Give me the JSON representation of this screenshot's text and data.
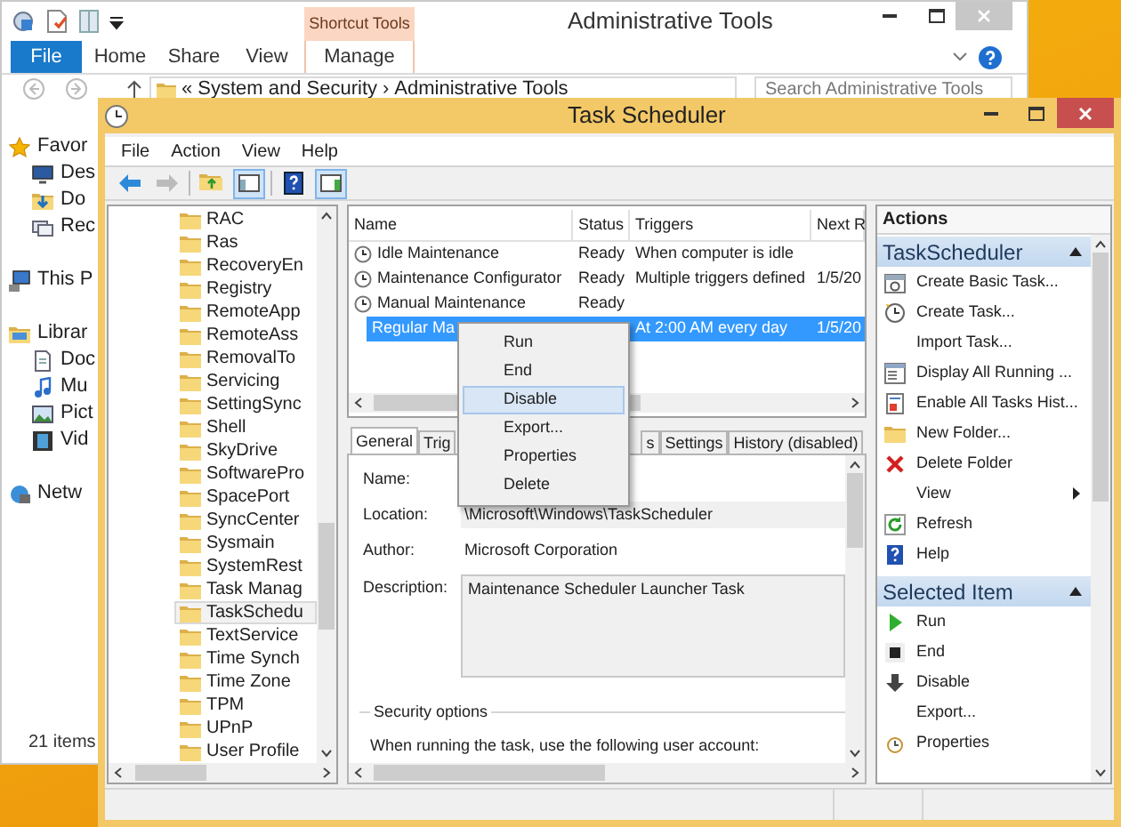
{
  "explorer": {
    "title": "Administrative Tools",
    "context_tab": "Shortcut Tools",
    "ribbon_tabs": [
      {
        "label": "File",
        "kind": "file"
      },
      {
        "label": "Home",
        "kind": "tab"
      },
      {
        "label": "Share",
        "kind": "tab"
      },
      {
        "label": "View",
        "kind": "tab"
      },
      {
        "label": "Manage",
        "kind": "contextual"
      }
    ],
    "address": {
      "overflow": "«",
      "parts": [
        "System and Security",
        "Administrative Tools"
      ],
      "separator": "›"
    },
    "search": {
      "placeholder": "Search Administrative Tools"
    },
    "nav": [
      {
        "label": "Favor",
        "kind": "favorites",
        "children": [
          {
            "label": "Des",
            "kind": "desktop"
          },
          {
            "label": "Do",
            "kind": "downloads"
          },
          {
            "label": "Rec",
            "kind": "recent"
          }
        ]
      },
      {
        "label": "This P",
        "kind": "pc"
      },
      {
        "label": "Librar",
        "kind": "libraries",
        "children": [
          {
            "label": "Doc",
            "kind": "documents"
          },
          {
            "label": "Mu",
            "kind": "music"
          },
          {
            "label": "Pict",
            "kind": "pictures"
          },
          {
            "label": "Vid",
            "kind": "videos"
          }
        ]
      },
      {
        "label": "Netw",
        "kind": "network"
      }
    ],
    "status": "21 items"
  },
  "task_scheduler": {
    "title": "Task Scheduler",
    "menu": [
      "File",
      "Action",
      "View",
      "Help"
    ],
    "toolbar": [
      {
        "kind": "back",
        "pressed": false,
        "disabled": false
      },
      {
        "kind": "forward",
        "pressed": false,
        "disabled": true
      },
      {
        "kind": "up",
        "pressed": false,
        "disabled": false
      },
      {
        "kind": "tree",
        "pressed": true,
        "disabled": false
      },
      {
        "kind": "help",
        "pressed": false,
        "disabled": false
      },
      {
        "kind": "actions",
        "pressed": true,
        "disabled": false
      }
    ],
    "tree": [
      {
        "label": "RAC",
        "selected": false
      },
      {
        "label": "Ras",
        "selected": false
      },
      {
        "label": "RecoveryEn",
        "selected": false
      },
      {
        "label": "Registry",
        "selected": false
      },
      {
        "label": "RemoteApp",
        "selected": false
      },
      {
        "label": "RemoteAss",
        "selected": false
      },
      {
        "label": "RemovalTo",
        "selected": false
      },
      {
        "label": "Servicing",
        "selected": false
      },
      {
        "label": "SettingSync",
        "selected": false
      },
      {
        "label": "Shell",
        "selected": false
      },
      {
        "label": "SkyDrive",
        "selected": false
      },
      {
        "label": "SoftwarePro",
        "selected": false
      },
      {
        "label": "SpacePort",
        "selected": false
      },
      {
        "label": "SyncCenter",
        "selected": false
      },
      {
        "label": "Sysmain",
        "selected": false
      },
      {
        "label": "SystemRest",
        "selected": false
      },
      {
        "label": "Task Manag",
        "selected": false
      },
      {
        "label": "TaskSchedu",
        "selected": true
      },
      {
        "label": "TextService",
        "selected": false
      },
      {
        "label": "Time Synch",
        "selected": false
      },
      {
        "label": "Time Zone",
        "selected": false
      },
      {
        "label": "TPM",
        "selected": false
      },
      {
        "label": "UPnP",
        "selected": false
      },
      {
        "label": "User Profile",
        "selected": false
      }
    ],
    "tasks": {
      "columns": [
        "Name",
        "Status",
        "Triggers",
        "Next R"
      ],
      "rows": [
        {
          "name": "Idle Maintenance",
          "status": "Ready",
          "triggers": "When computer is idle",
          "selected": false
        },
        {
          "name": "Maintenance Configurator",
          "status": "Ready",
          "triggers": "Multiple triggers defined",
          "next_run": "1/5/20",
          "selected": false
        },
        {
          "name": "Manual Maintenance",
          "status": "Ready",
          "selected": false
        },
        {
          "name": "Regular Ma",
          "triggers": "At 2:00 AM every day",
          "next_run": "1/5/20",
          "selected": true
        }
      ]
    },
    "context_menu": [
      {
        "label": "Run",
        "selected": false
      },
      {
        "label": "End",
        "selected": false
      },
      {
        "label": "Disable",
        "selected": true
      },
      {
        "label": "Export...",
        "selected": false
      },
      {
        "label": "Properties",
        "selected": false
      },
      {
        "label": "Delete",
        "selected": false
      }
    ],
    "detail_tabs": [
      {
        "label": "General",
        "selected": true
      },
      {
        "label": "Trig",
        "selected": false
      },
      {
        "label": "s",
        "selected": false
      },
      {
        "label": "Settings",
        "selected": false
      },
      {
        "label": "History (disabled)",
        "selected": false
      }
    ],
    "fields": [
      {
        "label": "Name:",
        "kind": "line"
      },
      {
        "label": "Location:",
        "value": "\\Microsoft\\Windows\\TaskScheduler",
        "kind": "box"
      },
      {
        "label": "Author:",
        "value": "Microsoft Corporation",
        "kind": "line"
      },
      {
        "label": "Description:",
        "value": "Maintenance Scheduler Launcher Task",
        "kind": "multiline"
      }
    ],
    "security": {
      "title": "Security options",
      "text": "When running the task, use the following user account:"
    },
    "actions": {
      "title": "Actions",
      "sections": [
        {
          "title": "TaskScheduler",
          "expanded": true,
          "items": [
            {
              "label": "Create Basic Task...",
              "kind": "basic-task"
            },
            {
              "label": "Create Task...",
              "kind": "create-task"
            },
            {
              "label": "Import Task...",
              "kind": "plain"
            },
            {
              "label": "Display All Running ...",
              "kind": "running"
            },
            {
              "label": "Enable All Tasks Hist...",
              "kind": "history"
            },
            {
              "label": "New Folder...",
              "kind": "new-folder"
            },
            {
              "label": "Delete Folder",
              "kind": "delete"
            },
            {
              "label": "View",
              "kind": "submenu"
            },
            {
              "label": "Refresh",
              "kind": "refresh"
            },
            {
              "label": "Help",
              "kind": "help"
            }
          ]
        },
        {
          "title": "Selected Item",
          "expanded": true,
          "items": [
            {
              "label": "Run",
              "kind": "run"
            },
            {
              "label": "End",
              "kind": "end"
            },
            {
              "label": "Disable",
              "kind": "disable"
            },
            {
              "label": "Export...",
              "kind": "plain"
            },
            {
              "label": "Properties",
              "kind": "properties"
            }
          ]
        }
      ]
    }
  }
}
